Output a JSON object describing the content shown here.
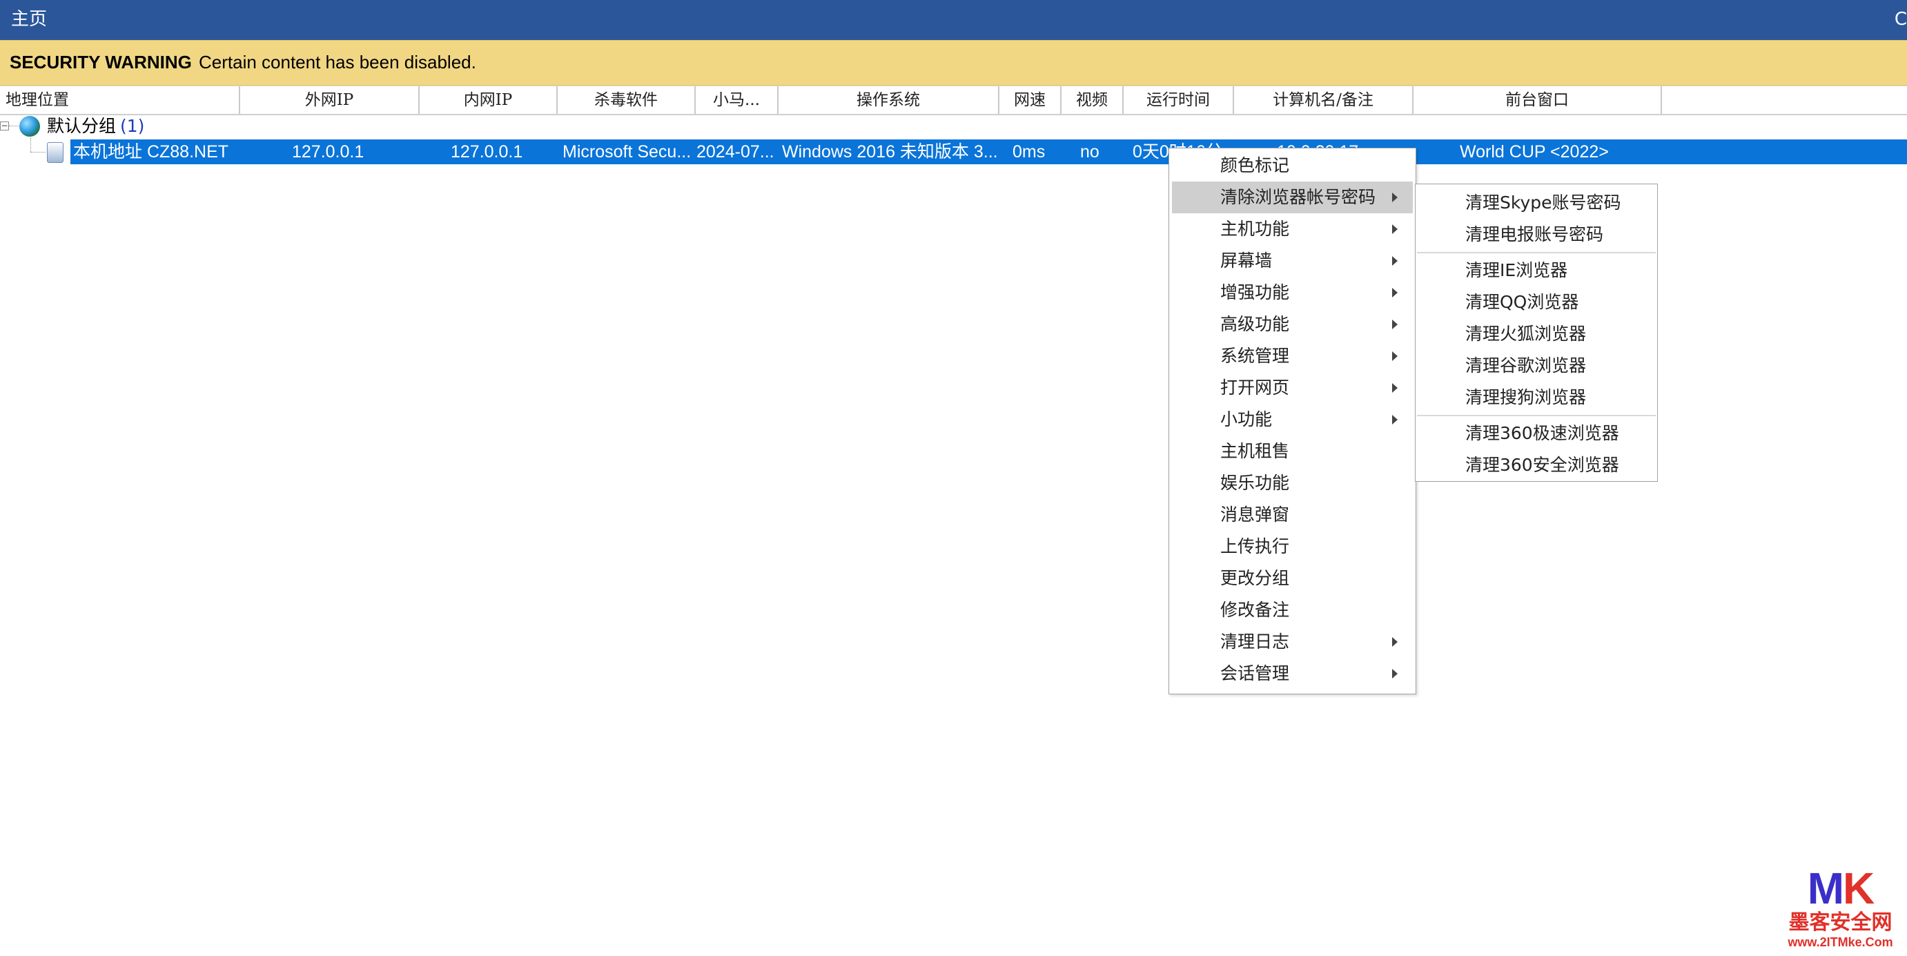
{
  "window": {
    "title": "主页",
    "edge_glyph": "C"
  },
  "security_bar": {
    "title": "SECURITY WARNING",
    "message": "Certain content has been disabled."
  },
  "columns": [
    "地理位置",
    "外网IP",
    "内网IP",
    "杀毒软件",
    "小马...",
    "操作系统",
    "网速",
    "视频",
    "运行时间",
    "计算机名/备注",
    "前台窗口"
  ],
  "tree": {
    "group": {
      "name": "默认分组",
      "count": "(1)"
    },
    "host": {
      "location": "本机地址  CZ88.NET",
      "wan_ip": "127.0.0.1",
      "lan_ip": "127.0.0.1",
      "antivirus": "Microsoft Secu...",
      "version": "2024-07...",
      "os": "Windows 2016 未知版本 3...",
      "speed": "0ms",
      "video": "no",
      "uptime": "0天0时16分",
      "computer_name": "10.0.20.17",
      "foreground": "World CUP <2022>"
    }
  },
  "context_menu": [
    {
      "label": "颜色标记",
      "submenu": false
    },
    {
      "label": "清除浏览器帐号密码",
      "submenu": true,
      "highlighted": true
    },
    {
      "label": "主机功能",
      "submenu": true
    },
    {
      "label": "屏幕墙",
      "submenu": true
    },
    {
      "label": "增强功能",
      "submenu": true
    },
    {
      "label": "高级功能",
      "submenu": true
    },
    {
      "label": "系统管理",
      "submenu": true
    },
    {
      "label": "打开网页",
      "submenu": true
    },
    {
      "label": "小功能",
      "submenu": true
    },
    {
      "label": "主机租售",
      "submenu": false
    },
    {
      "label": "娱乐功能",
      "submenu": false
    },
    {
      "label": "消息弹窗",
      "submenu": false
    },
    {
      "label": "上传执行",
      "submenu": false
    },
    {
      "label": "更改分组",
      "submenu": false
    },
    {
      "label": "修改备注",
      "submenu": false
    },
    {
      "label": "清理日志",
      "submenu": true
    },
    {
      "label": "会话管理",
      "submenu": true
    }
  ],
  "submenu": [
    "清理Skype账号密码",
    "清理电报账号密码",
    "清理IE浏览器",
    "清理QQ浏览器",
    "清理火狐浏览器",
    "清理谷歌浏览器",
    "清理搜狗浏览器",
    "清理360极速浏览器",
    "清理360安全浏览器"
  ],
  "watermark": {
    "logo_m": "M",
    "logo_k": "K",
    "name": "墨客安全网",
    "url": "www.2ITMke.Com"
  }
}
